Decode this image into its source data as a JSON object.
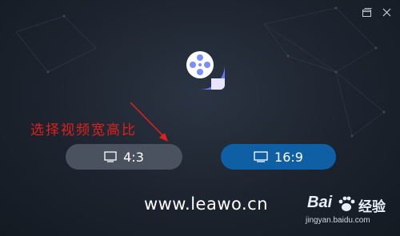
{
  "titlebar": {
    "restore_icon": "restore-window-icon",
    "close_icon": "close-icon"
  },
  "logo": {
    "icon": "video-reel-logo-icon",
    "colors": [
      "#5b6cff",
      "#7fd6ff"
    ]
  },
  "annotation": {
    "text": "选择视频宽高比",
    "color": "#e0201c"
  },
  "buttons": {
    "ratio_43": {
      "label": "4:3",
      "icon": "screen-icon"
    },
    "ratio_169": {
      "label": "16:9",
      "icon": "screen-icon",
      "color": "#0e5fa3"
    }
  },
  "website": "www.leawo.cn",
  "watermark": {
    "brand_left": "Bai",
    "brand_right": "经验",
    "url": "jingyan.baidu.com"
  }
}
